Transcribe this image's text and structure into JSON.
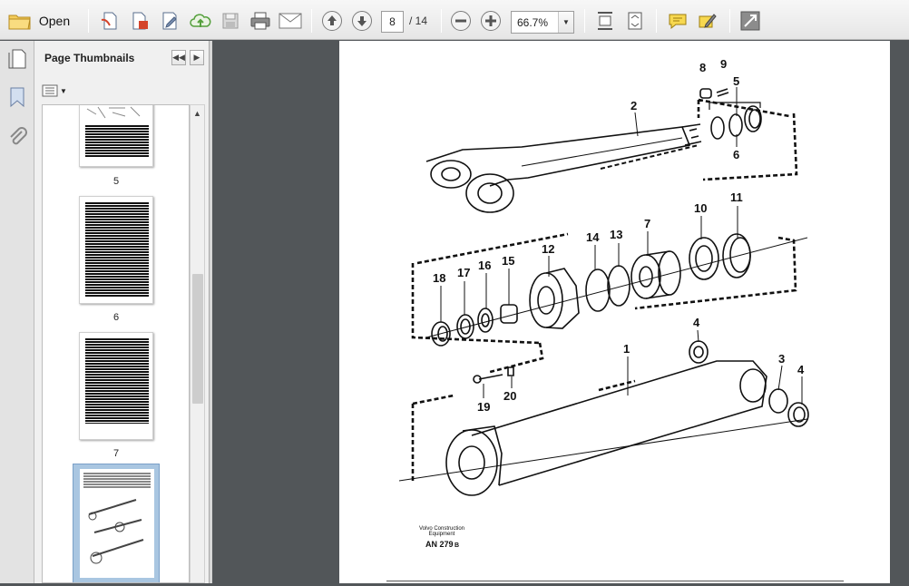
{
  "toolbar": {
    "open_label": "Open",
    "current_page": "8",
    "page_total": "/ 14",
    "zoom": "66.7%"
  },
  "panel": {
    "title": "Page Thumbnails"
  },
  "thumbnails": [
    {
      "page": "5"
    },
    {
      "page": "6"
    },
    {
      "page": "7"
    }
  ],
  "document": {
    "part_labels": [
      "8",
      "9",
      "5",
      "2",
      "6",
      "11",
      "10",
      "7",
      "14",
      "13",
      "12",
      "15",
      "16",
      "17",
      "18",
      "4",
      "1",
      "3",
      "4",
      "19",
      "20"
    ],
    "company": "Volvo Construction",
    "company_line2": "Equipment",
    "figure_code": "AN 279",
    "figure_suffix": "B"
  }
}
